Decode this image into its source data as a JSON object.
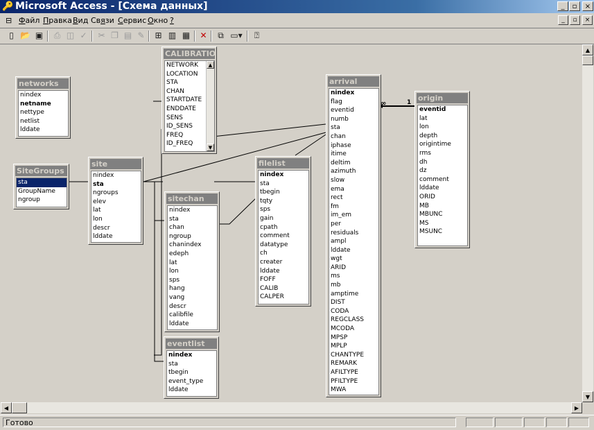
{
  "window": {
    "title": "Microsoft Access - [Схема данных]",
    "buttons": [
      "_",
      "▫",
      "×"
    ]
  },
  "menu": {
    "items": [
      {
        "label": "Файл",
        "ul": "Ф"
      },
      {
        "label": "Правка",
        "ul": "П"
      },
      {
        "label": "Вид",
        "ul": "В"
      },
      {
        "label": "Связи",
        "ul": "я"
      },
      {
        "label": "Сервис",
        "ul": "С"
      },
      {
        "label": "Окно",
        "ul": "О"
      },
      {
        "label": "?",
        "ul": "?"
      }
    ],
    "mdi_buttons": [
      "_",
      "▫",
      "×"
    ]
  },
  "toolbar": {
    "icons": [
      "relationships-icon",
      "new-icon",
      "open-icon",
      "save-icon",
      "print-icon",
      "print-preview-icon",
      "spelling-icon",
      "cut-icon",
      "copy-icon",
      "paste-icon",
      "format-painter-icon",
      "show-table-icon",
      "show-direct-icon",
      "show-all-icon",
      "delete-icon",
      "new-object-icon",
      "properties-icon",
      "help-icon"
    ]
  },
  "tables": {
    "calibration": {
      "title": "CALIBRATION",
      "fields": [
        {
          "n": "NETWORK"
        },
        {
          "n": "LOCATION"
        },
        {
          "n": "STA"
        },
        {
          "n": "CHAN"
        },
        {
          "n": "STARTDATE"
        },
        {
          "n": "ENDDATE"
        },
        {
          "n": "SENS"
        },
        {
          "n": "ID_SENS"
        },
        {
          "n": "FREQ"
        },
        {
          "n": "ID_FREQ"
        }
      ]
    },
    "networks": {
      "title": "networks",
      "fields": [
        {
          "n": "nindex"
        },
        {
          "n": "netname",
          "pk": true
        },
        {
          "n": "nettype"
        },
        {
          "n": "netlist"
        },
        {
          "n": "lddate"
        }
      ]
    },
    "sitegroups": {
      "title": "SiteGroups",
      "fields": [
        {
          "n": "sta",
          "sel": true
        },
        {
          "n": "GroupName"
        },
        {
          "n": "ngroup"
        }
      ]
    },
    "site": {
      "title": "site",
      "fields": [
        {
          "n": "nindex"
        },
        {
          "n": "sta",
          "pk": true
        },
        {
          "n": "ngroups"
        },
        {
          "n": "elev"
        },
        {
          "n": "lat"
        },
        {
          "n": "lon"
        },
        {
          "n": "descr"
        },
        {
          "n": "lddate"
        }
      ]
    },
    "sitechan": {
      "title": "sitechan",
      "fields": [
        {
          "n": "nindex"
        },
        {
          "n": "sta"
        },
        {
          "n": "chan"
        },
        {
          "n": "ngroup"
        },
        {
          "n": "chanindex"
        },
        {
          "n": "edeph"
        },
        {
          "n": "lat"
        },
        {
          "n": "lon"
        },
        {
          "n": "sps"
        },
        {
          "n": "hang"
        },
        {
          "n": "vang"
        },
        {
          "n": "descr"
        },
        {
          "n": "calibfile"
        },
        {
          "n": "lddate"
        }
      ]
    },
    "eventlist": {
      "title": "eventlist",
      "fields": [
        {
          "n": "nindex",
          "pk": true
        },
        {
          "n": "sta"
        },
        {
          "n": "tbegin"
        },
        {
          "n": "event_type"
        },
        {
          "n": "lddate"
        }
      ]
    },
    "filelist": {
      "title": "filelist",
      "fields": [
        {
          "n": "nindex",
          "pk": true
        },
        {
          "n": "sta"
        },
        {
          "n": "tbegin"
        },
        {
          "n": "tqty"
        },
        {
          "n": "sps"
        },
        {
          "n": "gain"
        },
        {
          "n": "cpath"
        },
        {
          "n": "comment"
        },
        {
          "n": "datatype"
        },
        {
          "n": "ch"
        },
        {
          "n": "creater"
        },
        {
          "n": "lddate"
        },
        {
          "n": "FOFF"
        },
        {
          "n": "CALIB"
        },
        {
          "n": "CALPER"
        }
      ]
    },
    "arrival": {
      "title": "arrival",
      "fields": [
        {
          "n": "nindex",
          "pk": true
        },
        {
          "n": "flag"
        },
        {
          "n": "eventid"
        },
        {
          "n": "numb"
        },
        {
          "n": "sta"
        },
        {
          "n": "chan"
        },
        {
          "n": "iphase"
        },
        {
          "n": "itime"
        },
        {
          "n": "deltim"
        },
        {
          "n": "azimuth"
        },
        {
          "n": "slow"
        },
        {
          "n": "ema"
        },
        {
          "n": "rect"
        },
        {
          "n": "fm"
        },
        {
          "n": "im_em"
        },
        {
          "n": "per"
        },
        {
          "n": "residuals"
        },
        {
          "n": "ampl"
        },
        {
          "n": "lddate"
        },
        {
          "n": "wgt"
        },
        {
          "n": "ARID"
        },
        {
          "n": "ms"
        },
        {
          "n": "mb"
        },
        {
          "n": "amptime"
        },
        {
          "n": "DIST"
        },
        {
          "n": "CODA"
        },
        {
          "n": "REGCLASS"
        },
        {
          "n": "MCODA"
        },
        {
          "n": "MPSP"
        },
        {
          "n": "MPLP"
        },
        {
          "n": "CHANTYPE"
        },
        {
          "n": "REMARK"
        },
        {
          "n": "AFILTYPE"
        },
        {
          "n": "PFILTYPE"
        },
        {
          "n": "MWA"
        }
      ]
    },
    "origin": {
      "title": "origin",
      "fields": [
        {
          "n": "eventid",
          "pk": true
        },
        {
          "n": "lat"
        },
        {
          "n": "lon"
        },
        {
          "n": "depth"
        },
        {
          "n": "origintime"
        },
        {
          "n": "rms"
        },
        {
          "n": "dh"
        },
        {
          "n": "dz"
        },
        {
          "n": "comment"
        },
        {
          "n": "lddate"
        },
        {
          "n": "ORID"
        },
        {
          "n": "MB"
        },
        {
          "n": "MBUNC"
        },
        {
          "n": "MS"
        },
        {
          "n": "MSUNC"
        }
      ]
    }
  },
  "relationship": {
    "one": "1",
    "many": "∞"
  },
  "status": {
    "text": "Готово"
  }
}
